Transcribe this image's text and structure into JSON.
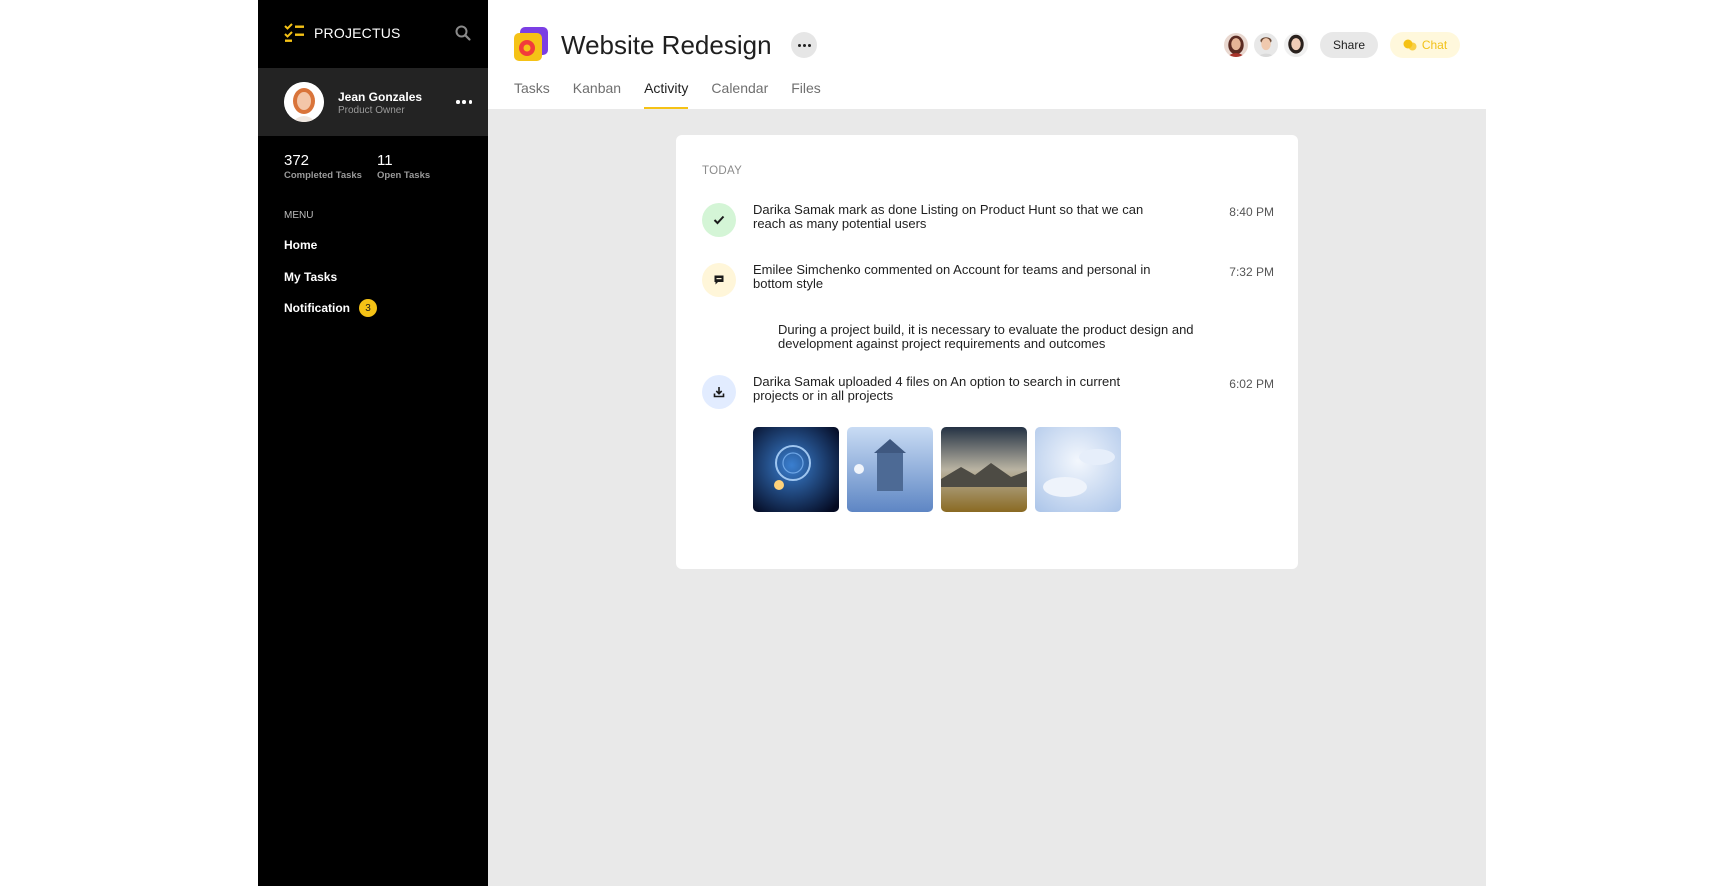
{
  "app": {
    "brand": "PROJECTUS"
  },
  "profile": {
    "name": "Jean Gonzales",
    "role": "Product Owner"
  },
  "stats": [
    {
      "value": "372",
      "label": "Completed Tasks"
    },
    {
      "value": "11",
      "label": "Open Tasks"
    }
  ],
  "menu": {
    "title": "MENU",
    "items": [
      {
        "label": "Home"
      },
      {
        "label": "My Tasks"
      },
      {
        "label": "Notification",
        "badge": "3"
      }
    ]
  },
  "project": {
    "title": "Website Redesign",
    "share_label": "Share",
    "chat_label": "Chat",
    "tabs": [
      {
        "label": "Tasks"
      },
      {
        "label": "Kanban"
      },
      {
        "label": "Activity",
        "active": true
      },
      {
        "label": "Calendar"
      },
      {
        "label": "Files"
      }
    ]
  },
  "activity": {
    "day_label": "TODAY",
    "items": [
      {
        "icon": "check-icon",
        "text": "Darika Samak mark as done Listing on Product Hunt so that we can reach as many potential users",
        "time": "8:40 PM"
      },
      {
        "icon": "comment-icon",
        "text": "Emilee Simchenko commented on Account for teams and personal in bottom style",
        "time": "7:32 PM",
        "quote": "During a project build, it is necessary to evaluate the product design and development against project requirements and outcomes"
      },
      {
        "icon": "download-icon",
        "text": "Darika Samak uploaded 4 files on An option to search in current projects or in all projects",
        "time": "6:02 PM"
      }
    ]
  },
  "colors": {
    "accent": "#f5c216",
    "sidebar_bg": "#000000",
    "check_bg": "#d4f5d6",
    "comment_bg": "#fff6d9",
    "download_bg": "#e2ecff"
  }
}
